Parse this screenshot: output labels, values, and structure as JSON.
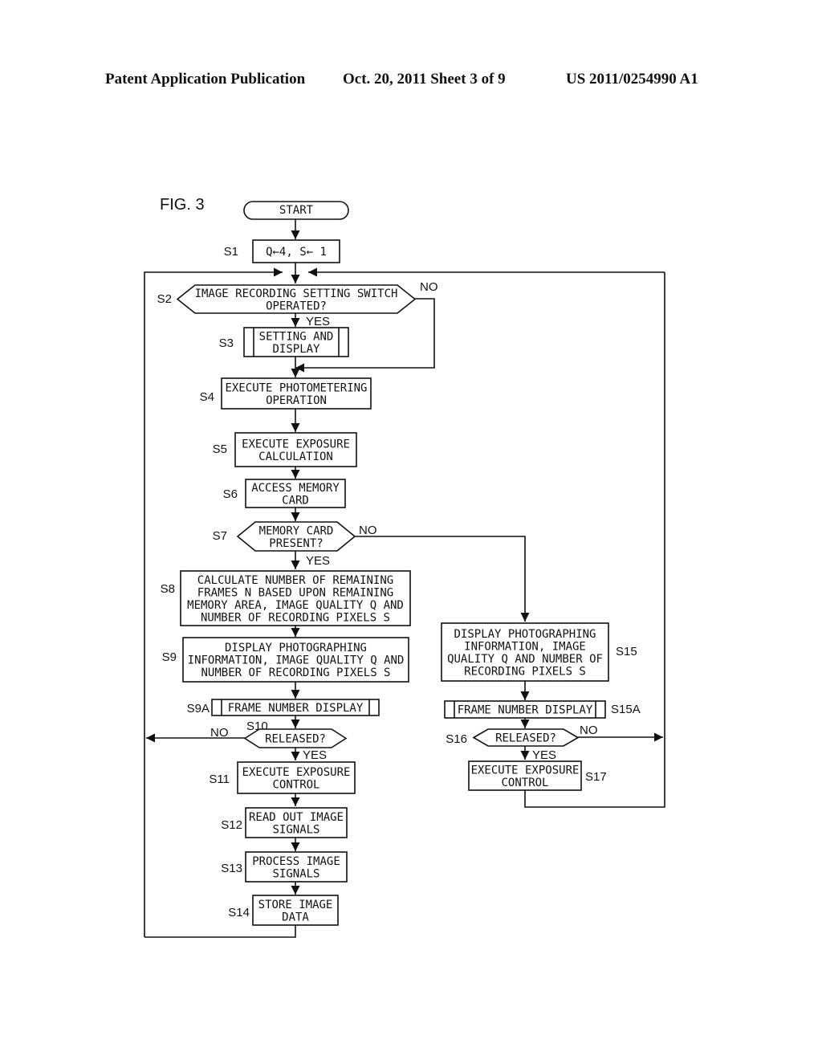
{
  "header": {
    "publication": "Patent Application Publication",
    "date_sheet": "Oct. 20, 2011   Sheet 3 of 9",
    "number": "US 2011/0254990 A1"
  },
  "figure": {
    "label": "FIG. 3",
    "start": "START",
    "yes": "YES",
    "no": "NO",
    "steps": {
      "S1": {
        "id": "S1",
        "lines": [
          "Q←4,  S← 1"
        ]
      },
      "S2": {
        "id": "S2",
        "lines": [
          "IMAGE RECORDING SETTING SWITCH",
          "OPERATED?"
        ]
      },
      "S3": {
        "id": "S3",
        "lines": [
          "SETTING AND",
          "DISPLAY"
        ]
      },
      "S4": {
        "id": "S4",
        "lines": [
          "EXECUTE PHOTOMETERING",
          "OPERATION"
        ]
      },
      "S5": {
        "id": "S5",
        "lines": [
          "EXECUTE EXPOSURE",
          "CALCULATION"
        ]
      },
      "S6": {
        "id": "S6",
        "lines": [
          "ACCESS MEMORY",
          "CARD"
        ]
      },
      "S7": {
        "id": "S7",
        "lines": [
          "MEMORY CARD",
          "PRESENT?"
        ]
      },
      "S8": {
        "id": "S8",
        "lines": [
          "CALCULATE NUMBER OF REMAINING",
          "FRAMES N BASED UPON REMAINING",
          "MEMORY AREA, IMAGE QUALITY Q AND",
          "NUMBER OF RECORDING PIXELS S"
        ]
      },
      "S9": {
        "id": "S9",
        "lines": [
          "DISPLAY PHOTOGRAPHING",
          "INFORMATION, IMAGE QUALITY Q AND",
          "NUMBER OF RECORDING PIXELS S"
        ]
      },
      "S9A": {
        "id": "S9A",
        "lines": [
          "FRAME NUMBER DISPLAY"
        ]
      },
      "S10": {
        "id": "S10",
        "lines": [
          "RELEASED?"
        ]
      },
      "S11": {
        "id": "S11",
        "lines": [
          "EXECUTE EXPOSURE",
          "CONTROL"
        ]
      },
      "S12": {
        "id": "S12",
        "lines": [
          "READ OUT IMAGE",
          "SIGNALS"
        ]
      },
      "S13": {
        "id": "S13",
        "lines": [
          "PROCESS IMAGE",
          "SIGNALS"
        ]
      },
      "S14": {
        "id": "S14",
        "lines": [
          "STORE IMAGE",
          "DATA"
        ]
      },
      "S15": {
        "id": "S15",
        "lines": [
          "DISPLAY PHOTOGRAPHING",
          "INFORMATION, IMAGE",
          "QUALITY Q AND NUMBER OF",
          "RECORDING PIXELS S"
        ]
      },
      "S15A": {
        "id": "S15A",
        "lines": [
          "FRAME NUMBER DISPLAY"
        ]
      },
      "S16": {
        "id": "S16",
        "lines": [
          "RELEASED?"
        ]
      },
      "S17": {
        "id": "S17",
        "lines": [
          "EXECUTE EXPOSURE",
          "CONTROL"
        ]
      }
    }
  }
}
